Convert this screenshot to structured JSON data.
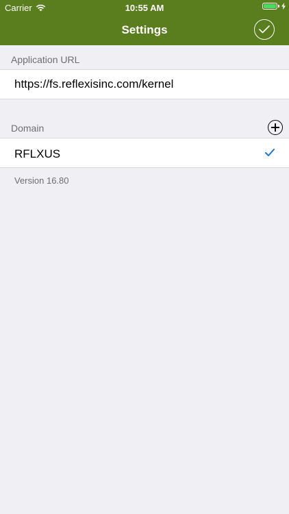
{
  "status_bar": {
    "carrier": "Carrier",
    "time": "10:55 AM",
    "battery_level": 1.0,
    "battery_color": "#4cd964",
    "icons": [
      "wifi-icon",
      "battery-icon",
      "charging-icon"
    ]
  },
  "nav": {
    "title": "Settings",
    "done_icon": "checkmark-circle-icon",
    "background_color": "#5a7d1e"
  },
  "app_url": {
    "header": "Application URL",
    "value": "https://fs.reflexisinc.com/kernel"
  },
  "domain": {
    "header": "Domain",
    "add_icon": "plus-circle-icon",
    "items": [
      {
        "label": "RFLXUS",
        "selected": true
      }
    ],
    "check_color": "#1a73d9"
  },
  "version": "Version 16.80"
}
